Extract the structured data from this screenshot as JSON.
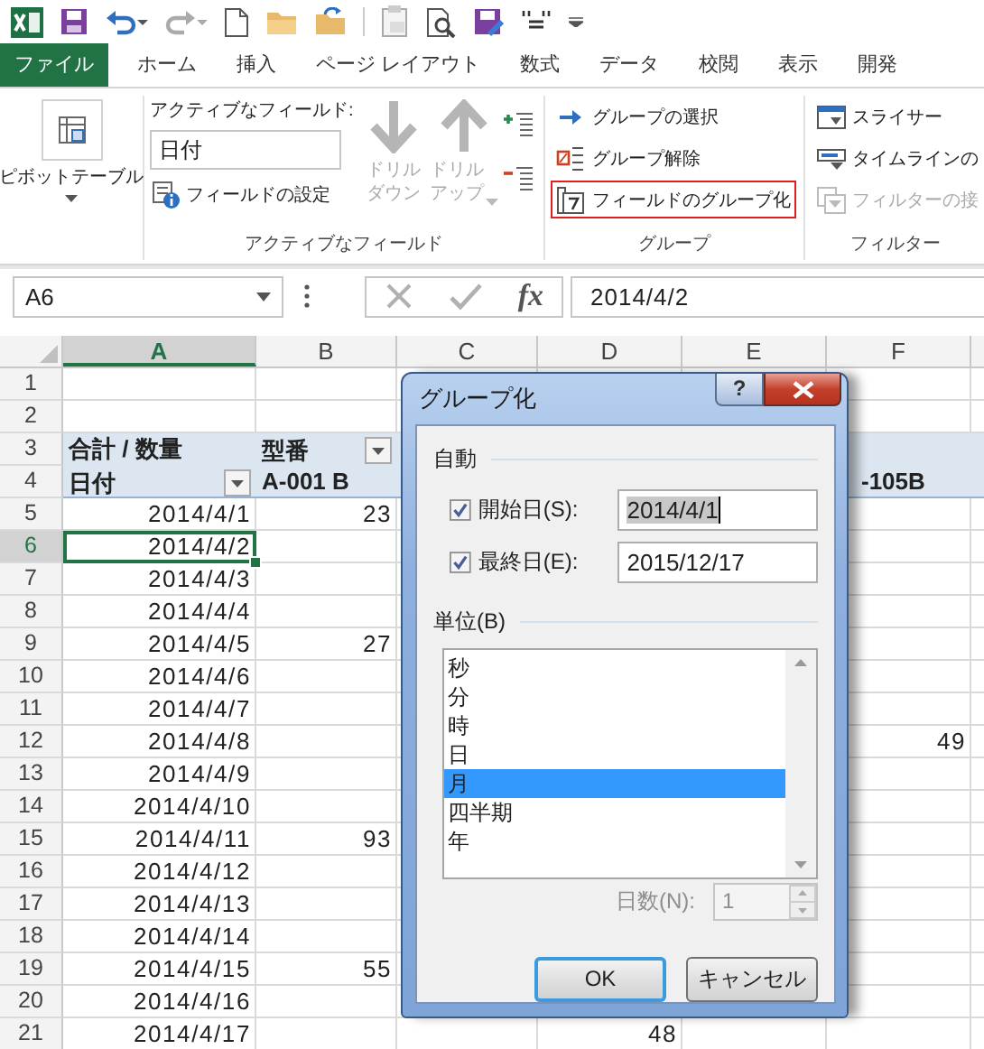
{
  "ribbon_tabs": [
    {
      "label": "ファイル",
      "kind": "file"
    },
    {
      "label": "ホーム",
      "kind": "tab"
    },
    {
      "label": "挿入",
      "kind": "tab"
    },
    {
      "label": "ページ レイアウト",
      "kind": "tab"
    },
    {
      "label": "数式",
      "kind": "tab"
    },
    {
      "label": "データ",
      "kind": "tab"
    },
    {
      "label": "校閲",
      "kind": "tab"
    },
    {
      "label": "表示",
      "kind": "tab"
    },
    {
      "label": "開発",
      "kind": "tab"
    }
  ],
  "ribbon": {
    "groups": [
      {
        "kind": "pivot",
        "button": {
          "label": "ピボットテーブル",
          "caret": true
        }
      },
      {
        "kind": "active-field",
        "label": "アクティブなフィールド",
        "caption": "アクティブなフィールド:",
        "field_value": "日付",
        "settings_button": "フィールドの設定",
        "drill_buttons": [
          {
            "lines": [
              "ドリル",
              "ダウン"
            ],
            "disabled": true,
            "caret": false
          },
          {
            "lines": [
              "ドリル",
              "アップ"
            ],
            "disabled": true,
            "caret": true
          }
        ]
      },
      {
        "kind": "stack",
        "label": "グループ",
        "buttons": [
          {
            "label": "グループの選択",
            "disabled": false,
            "highlighted": false
          },
          {
            "label": "グループ解除",
            "disabled": false,
            "highlighted": false
          },
          {
            "label": "フィールドのグループ化",
            "disabled": false,
            "highlighted": true
          }
        ]
      },
      {
        "kind": "stack",
        "label": "フィルター",
        "buttons": [
          {
            "label": "スライサー",
            "disabled": false,
            "highlighted": false
          },
          {
            "label": "タイムラインの",
            "disabled": false,
            "highlighted": false
          },
          {
            "label": "フィルターの接",
            "disabled": true,
            "highlighted": false
          }
        ]
      }
    ]
  },
  "formula_bar": {
    "name_box": "A6",
    "function_button": "fx",
    "formula": "2014/4/2"
  },
  "sheet": {
    "columns": [
      {
        "label": "A",
        "selected": true
      },
      {
        "label": "B",
        "selected": false
      },
      {
        "label": "C",
        "selected": false
      },
      {
        "label": "D",
        "selected": false
      },
      {
        "label": "E",
        "selected": false
      },
      {
        "label": "F",
        "selected": false
      }
    ],
    "rows": [
      {
        "label": "1",
        "selected": false,
        "kind": "plain"
      },
      {
        "label": "2",
        "selected": false,
        "kind": "plain"
      },
      {
        "label": "3",
        "selected": false,
        "kind": "pivot-header",
        "cells": [
          {
            "text": "合計 / 数量"
          },
          {
            "text": "型番",
            "filter": true
          }
        ]
      },
      {
        "label": "4",
        "selected": false,
        "kind": "pivot-header",
        "cells": [
          {
            "text": "日付",
            "filter": true
          },
          {
            "text": "A-001 B"
          },
          null,
          null,
          null,
          {
            "text": "-105B"
          }
        ]
      },
      {
        "label": "5",
        "selected": false,
        "kind": "data",
        "cells": [
          "2014/4/1",
          "23"
        ]
      },
      {
        "label": "6",
        "selected": true,
        "kind": "data",
        "cells": [
          "2014/4/2"
        ]
      },
      {
        "label": "7",
        "selected": false,
        "kind": "data",
        "cells": [
          "2014/4/3"
        ]
      },
      {
        "label": "8",
        "selected": false,
        "kind": "data",
        "cells": [
          "2014/4/4"
        ]
      },
      {
        "label": "9",
        "selected": false,
        "kind": "data",
        "cells": [
          "2014/4/5",
          "27"
        ]
      },
      {
        "label": "10",
        "selected": false,
        "kind": "data",
        "cells": [
          "2014/4/6"
        ]
      },
      {
        "label": "11",
        "selected": false,
        "kind": "data",
        "cells": [
          "2014/4/7"
        ]
      },
      {
        "label": "12",
        "selected": false,
        "kind": "data",
        "cells": [
          "2014/4/8",
          null,
          null,
          null,
          null,
          "49"
        ]
      },
      {
        "label": "13",
        "selected": false,
        "kind": "data",
        "cells": [
          "2014/4/9"
        ]
      },
      {
        "label": "14",
        "selected": false,
        "kind": "data",
        "cells": [
          "2014/4/10"
        ]
      },
      {
        "label": "15",
        "selected": false,
        "kind": "data",
        "cells": [
          "2014/4/11",
          "93"
        ]
      },
      {
        "label": "16",
        "selected": false,
        "kind": "data",
        "cells": [
          "2014/4/12"
        ]
      },
      {
        "label": "17",
        "selected": false,
        "kind": "data",
        "cells": [
          "2014/4/13"
        ]
      },
      {
        "label": "18",
        "selected": false,
        "kind": "data",
        "cells": [
          "2014/4/14"
        ]
      },
      {
        "label": "19",
        "selected": false,
        "kind": "data",
        "cells": [
          "2014/4/15",
          "55"
        ]
      },
      {
        "label": "20",
        "selected": false,
        "kind": "data",
        "cells": [
          "2014/4/16"
        ]
      },
      {
        "label": "21",
        "selected": false,
        "kind": "data",
        "cells": [
          "2014/4/17",
          null,
          null,
          "48"
        ]
      }
    ]
  },
  "dialog": {
    "title": "グループ化",
    "help_button": "?",
    "auto": {
      "label": "自動",
      "fields": [
        {
          "label": "開始日(S):",
          "checked": true,
          "value": "2014/4/1",
          "value_selected": true
        },
        {
          "label": "最終日(E):",
          "checked": true,
          "value": "2015/12/17",
          "value_selected": false
        }
      ]
    },
    "units": {
      "label": "単位(B)",
      "items": [
        {
          "label": "秒",
          "selected": false
        },
        {
          "label": "分",
          "selected": false
        },
        {
          "label": "時",
          "selected": false
        },
        {
          "label": "日",
          "selected": false
        },
        {
          "label": "月",
          "selected": true
        },
        {
          "label": "四半期",
          "selected": false
        },
        {
          "label": "年",
          "selected": false
        }
      ]
    },
    "days": {
      "label": "日数(N):",
      "value": "1",
      "disabled": true
    },
    "buttons": [
      {
        "label": "OK",
        "default": true
      },
      {
        "label": "キャンセル",
        "default": false
      }
    ]
  }
}
